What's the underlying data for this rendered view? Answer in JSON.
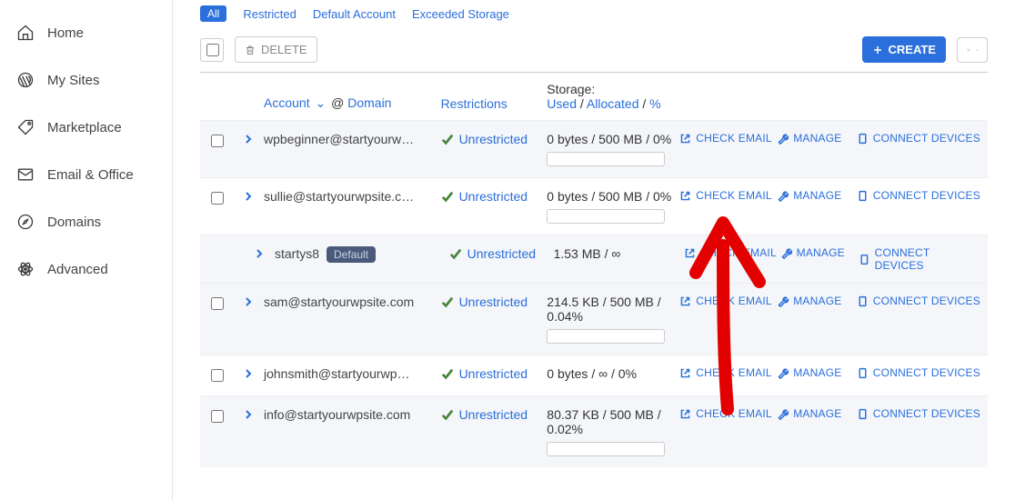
{
  "sidebar": {
    "items": [
      {
        "label": "Home",
        "icon": "home"
      },
      {
        "label": "My Sites",
        "icon": "wordpress"
      },
      {
        "label": "Marketplace",
        "icon": "tag"
      },
      {
        "label": "Email & Office",
        "icon": "mail"
      },
      {
        "label": "Domains",
        "icon": "compass"
      },
      {
        "label": "Advanced",
        "icon": "atom"
      }
    ]
  },
  "filters": {
    "all": "All",
    "restricted": "Restricted",
    "default_account": "Default Account",
    "exceeded": "Exceeded Storage"
  },
  "toolbar": {
    "delete": "DELETE",
    "create": "CREATE"
  },
  "table": {
    "header": {
      "account": "Account",
      "at": "@",
      "domain": "Domain",
      "restrictions": "Restrictions",
      "storage_label": "Storage:",
      "used": "Used",
      "sep": "/",
      "allocated": "Allocated",
      "percent": "%"
    },
    "actions": {
      "check_email": "CHECK EMAIL",
      "manage": "MANAGE",
      "connect": "CONNECT DEVICES"
    },
    "rows": [
      {
        "account": "wpbeginner@startyourw…",
        "restriction": "Unrestricted",
        "storage": "0 bytes / 500 MB / 0%",
        "bar": true,
        "alt": true,
        "child": false,
        "checkbox": true,
        "default_badge": false
      },
      {
        "account": "sullie@startyourwpsite.c…",
        "restriction": "Unrestricted",
        "storage": "0 bytes / 500 MB / 0%",
        "bar": true,
        "alt": false,
        "child": false,
        "checkbox": true,
        "default_badge": false
      },
      {
        "account": "startys8",
        "restriction": "Unrestricted",
        "storage": "1.53 MB / ∞",
        "bar": false,
        "alt": true,
        "child": true,
        "checkbox": false,
        "default_badge": true,
        "badge_text": "Default"
      },
      {
        "account": "sam@startyourwpsite.com",
        "restriction": "Unrestricted",
        "storage": "214.5 KB / 500 MB / 0.04%",
        "bar": true,
        "alt": true,
        "child": false,
        "checkbox": true,
        "default_badge": false
      },
      {
        "account": "johnsmith@startyourwp…",
        "restriction": "Unrestricted",
        "storage": "0 bytes / ∞ / 0%",
        "bar": false,
        "alt": false,
        "child": false,
        "checkbox": true,
        "default_badge": false
      },
      {
        "account": "info@startyourwpsite.com",
        "restriction": "Unrestricted",
        "storage": "80.37 KB / 500 MB / 0.02%",
        "bar": true,
        "alt": true,
        "child": false,
        "checkbox": true,
        "default_badge": false
      }
    ]
  }
}
